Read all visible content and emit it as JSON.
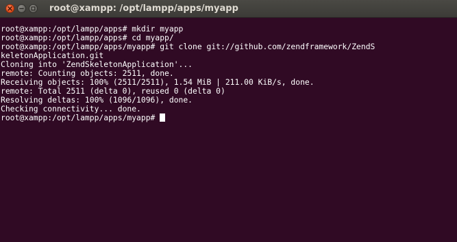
{
  "window": {
    "title": "root@xampp: /opt/lampp/apps/myapp"
  },
  "terminal": {
    "lines": [
      "root@xampp:/opt/lampp/apps# mkdir myapp",
      "root@xampp:/opt/lampp/apps# cd myapp/",
      "root@xampp:/opt/lampp/apps/myapp# git clone git://github.com/zendframework/ZendS",
      "keletonApplication.git",
      "Cloning into 'ZendSkeletonApplication'...",
      "remote: Counting objects: 2511, done.",
      "Receiving objects: 100% (2511/2511), 1.54 MiB | 211.00 KiB/s, done.",
      "remote: Total 2511 (delta 0), reused 0 (delta 0)",
      "Resolving deltas: 100% (1096/1096), done.",
      "Checking connectivity... done.",
      "root@xampp:/opt/lampp/apps/myapp#"
    ]
  },
  "icons": {
    "close": "close-icon",
    "minimize": "minimize-icon",
    "maximize": "maximize-icon"
  },
  "colors": {
    "background": "#300a24",
    "foreground": "#ffffff",
    "titlebar": "#3c3b37",
    "close_button": "#e95420"
  }
}
